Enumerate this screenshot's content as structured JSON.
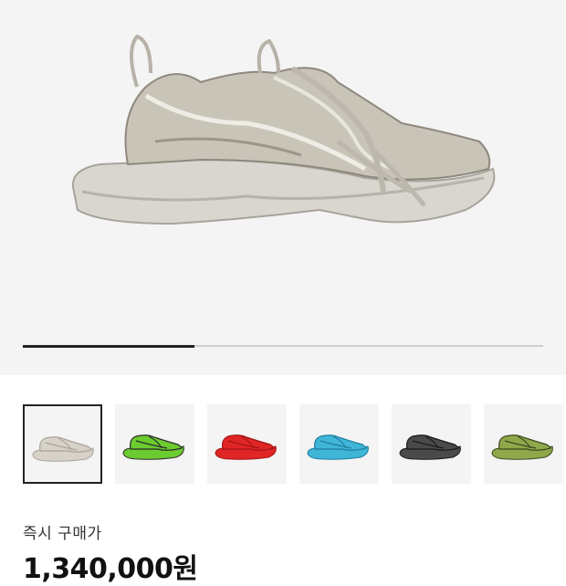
{
  "gallery": {
    "progress_fraction": 0.33,
    "selected_index": 0,
    "thumbnails": [
      {
        "color": "#d6d2c8",
        "accent": "#a9a39a"
      },
      {
        "color": "#6ccb2f",
        "accent": "#2b2b2b"
      },
      {
        "color": "#e02525",
        "accent": "#a31414"
      },
      {
        "color": "#3fb5d8",
        "accent": "#1f7fa0"
      },
      {
        "color": "#4a4a4a",
        "accent": "#1a1a1a"
      },
      {
        "color": "#8fa84a",
        "accent": "#3e4a22"
      }
    ]
  },
  "pricing": {
    "label": "즉시 구매가",
    "price": "1,340,000원"
  }
}
